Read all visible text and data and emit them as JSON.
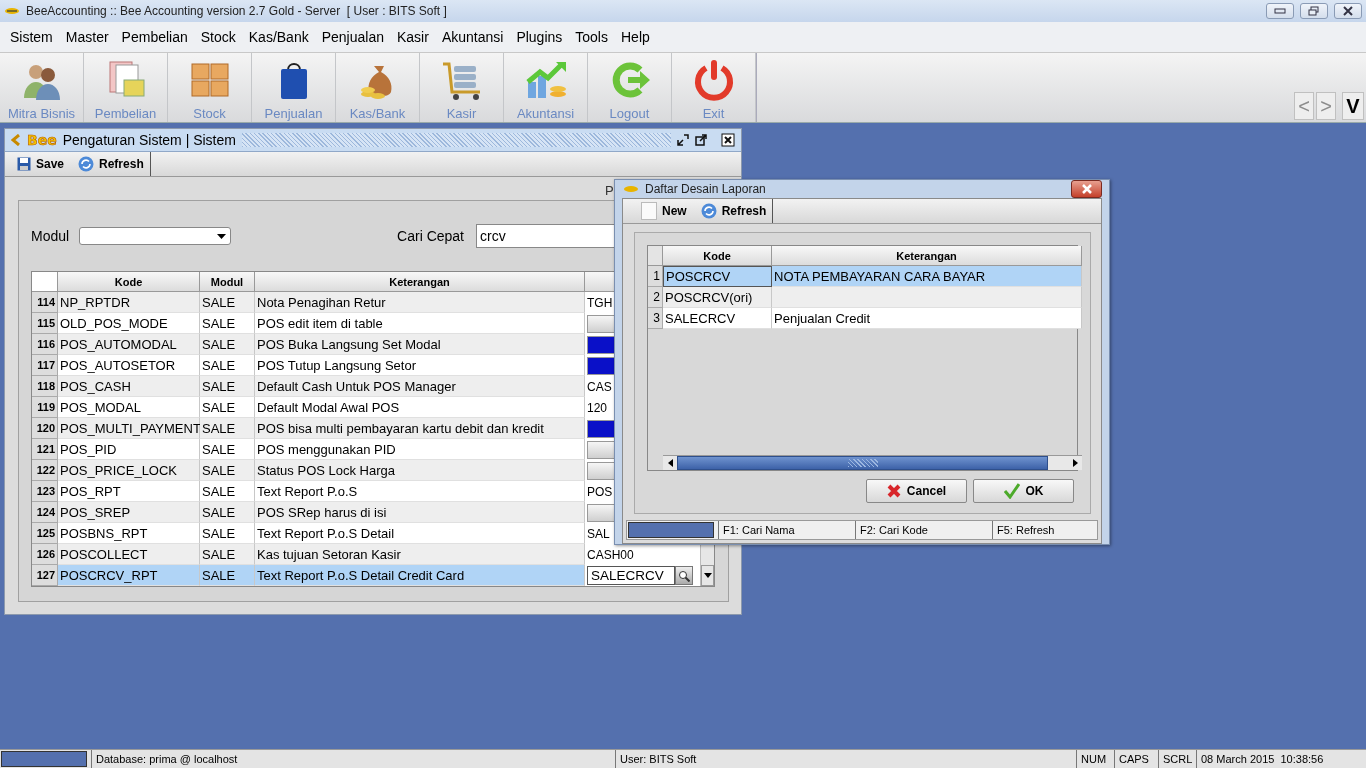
{
  "app": {
    "title": "BeeAccounting :: Bee Accounting version 2.7 Gold - Server  [ User : BITS Soft ]"
  },
  "menu": [
    "Sistem",
    "Master",
    "Pembelian",
    "Stock",
    "Kas/Bank",
    "Penjualan",
    "Kasir",
    "Akuntansi",
    "Plugins",
    "Tools",
    "Help"
  ],
  "toolbar": [
    {
      "label": "Mitra Bisnis",
      "kind": "partners"
    },
    {
      "label": "Pembelian",
      "kind": "purchase"
    },
    {
      "label": "Stock",
      "kind": "stock"
    },
    {
      "label": "Penjualan",
      "kind": "sales"
    },
    {
      "label": "Kas/Bank",
      "kind": "cash"
    },
    {
      "label": "Kasir",
      "kind": "cashier"
    },
    {
      "label": "Akuntansi",
      "kind": "accounting"
    },
    {
      "label": "Logout",
      "kind": "logout"
    },
    {
      "label": "Exit",
      "kind": "exit"
    }
  ],
  "nav_buttons": [
    {
      "label": "<",
      "disabled": true
    },
    {
      "label": ">",
      "disabled": true
    },
    {
      "label": "V",
      "disabled": false
    }
  ],
  "settings_window": {
    "title": "Pengaturan Sistem | Sistem",
    "logo": "Bee",
    "toolbar": [
      {
        "label": "Save",
        "kind": "save"
      },
      {
        "label": "Refresh",
        "kind": "refresh"
      }
    ],
    "cut_label": "P",
    "filter": {
      "modul_label": "Modul",
      "search_label": "Cari Cepat",
      "search_value": "crcv"
    },
    "table": {
      "columns": [
        "Kode",
        "Modul",
        "Keterangan"
      ],
      "rows": [
        {
          "no": "114",
          "kode": "NP_RPTDR",
          "modul": "SALE",
          "keterangan": "Nota Penagihan Retur",
          "value": {
            "kind": "text",
            "text": "TGH"
          },
          "selected": false
        },
        {
          "no": "115",
          "kode": "OLD_POS_MODE",
          "modul": "SALE",
          "keterangan": "POS edit item di table",
          "value": {
            "kind": "toggle",
            "on": false
          },
          "selected": false
        },
        {
          "no": "116",
          "kode": "POS_AUTOMODAL",
          "modul": "SALE",
          "keterangan": "POS Buka Langsung Set Modal",
          "value": {
            "kind": "toggle",
            "on": true
          },
          "selected": false
        },
        {
          "no": "117",
          "kode": "POS_AUTOSETOR",
          "modul": "SALE",
          "keterangan": "POS Tutup Langsung Setor",
          "value": {
            "kind": "toggle",
            "on": true
          },
          "selected": false
        },
        {
          "no": "118",
          "kode": "POS_CASH",
          "modul": "SALE",
          "keterangan": "Default Cash Untuk POS Manager",
          "value": {
            "kind": "text",
            "text": "CAS"
          },
          "selected": false
        },
        {
          "no": "119",
          "kode": "POS_MODAL",
          "modul": "SALE",
          "keterangan": "Default Modal Awal POS",
          "value": {
            "kind": "text",
            "text": "120"
          },
          "selected": false
        },
        {
          "no": "120",
          "kode": "POS_MULTI_PAYMENT",
          "modul": "SALE",
          "keterangan": "POS bisa multi pembayaran kartu debit dan kredit",
          "value": {
            "kind": "toggle",
            "on": true
          },
          "selected": false
        },
        {
          "no": "121",
          "kode": "POS_PID",
          "modul": "SALE",
          "keterangan": "POS menggunakan PID",
          "value": {
            "kind": "toggle",
            "on": false
          },
          "selected": false
        },
        {
          "no": "122",
          "kode": "POS_PRICE_LOCK",
          "modul": "SALE",
          "keterangan": "Status POS Lock Harga",
          "value": {
            "kind": "toggle",
            "on": false
          },
          "selected": false
        },
        {
          "no": "123",
          "kode": "POS_RPT",
          "modul": "SALE",
          "keterangan": "Text Report P.o.S",
          "value": {
            "kind": "text",
            "text": "POS"
          },
          "selected": false
        },
        {
          "no": "124",
          "kode": "POS_SREP",
          "modul": "SALE",
          "keterangan": "POS SRep harus di isi",
          "value": {
            "kind": "toggle",
            "on": false
          },
          "selected": false
        },
        {
          "no": "125",
          "kode": "POSBNS_RPT",
          "modul": "SALE",
          "keterangan": "Text Report P.o.S Detail",
          "value": {
            "kind": "text",
            "text": "SAL"
          },
          "selected": false
        },
        {
          "no": "126",
          "kode": "POSCOLLECT",
          "modul": "SALE",
          "keterangan": "Kas tujuan Setoran Kasir",
          "value": {
            "kind": "text",
            "text": "CASH00"
          },
          "selected": false
        },
        {
          "no": "127",
          "kode": "POSCRCV_RPT",
          "modul": "SALE",
          "keterangan": "Text Report P.o.S Detail Credit Card",
          "value": {
            "kind": "lookup",
            "text": "SALECRCV"
          },
          "selected": true
        }
      ]
    }
  },
  "dialog": {
    "title": "Daftar Desain Laporan",
    "toolbar": [
      {
        "label": "New",
        "kind": "new"
      },
      {
        "label": "Refresh",
        "kind": "refresh"
      }
    ],
    "table": {
      "columns": [
        "Kode",
        "Keterangan"
      ],
      "rows": [
        {
          "no": "1",
          "kode": "POSCRCV",
          "keterangan": "NOTA PEMBAYARAN CARA BAYAR",
          "selected": true
        },
        {
          "no": "2",
          "kode": "POSCRCV(ori)",
          "selected": false
        },
        {
          "no": "3",
          "kode": "SALECRCV",
          "keterangan": "Penjualan Credit",
          "selected": false
        }
      ]
    },
    "buttons": [
      {
        "label": "Cancel",
        "kind": "cancel"
      },
      {
        "label": "OK",
        "kind": "ok"
      }
    ],
    "status": [
      "F1: Cari Nama",
      "F2: Cari Kode",
      "F5: Refresh"
    ]
  },
  "status_bar": {
    "database": "Database: prima @ localhost",
    "user": "User: BITS Soft",
    "indicators": [
      "NUM",
      "CAPS",
      "SCRL"
    ],
    "datetime": "08 March 2015  10:38:56"
  }
}
